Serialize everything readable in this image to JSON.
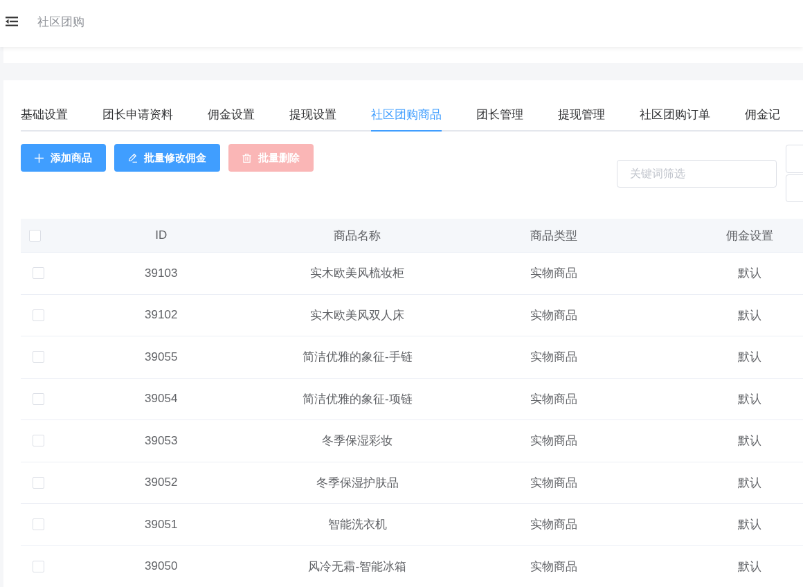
{
  "header": {
    "title": "社区团购"
  },
  "tabs": [
    {
      "label": "基础设置",
      "selected": false
    },
    {
      "label": "团长申请资料",
      "selected": false
    },
    {
      "label": "佣金设置",
      "selected": false
    },
    {
      "label": "提现设置",
      "selected": false
    },
    {
      "label": "社区团购商品",
      "selected": true
    },
    {
      "label": "团长管理",
      "selected": false
    },
    {
      "label": "提现管理",
      "selected": false
    },
    {
      "label": "社区团购订单",
      "selected": false
    },
    {
      "label": "佣金记",
      "selected": false
    }
  ],
  "toolbar": {
    "buttons": [
      {
        "kind": "add",
        "label": "添加商品",
        "disabled": false
      },
      {
        "kind": "edit",
        "label": "批量修改佣金",
        "disabled": false
      },
      {
        "kind": "delete",
        "label": "批量删除",
        "disabled": true
      }
    ],
    "search": {
      "placeholder": "关键词筛选"
    }
  },
  "table": {
    "columns": [
      "ID",
      "商品名称",
      "商品类型",
      "佣金设置"
    ],
    "select_all": {
      "checked": false
    },
    "rows": [
      {
        "checked": false,
        "id": "39103",
        "name": "实木欧美风梳妆柜",
        "type": "实物商品",
        "commission": "默认"
      },
      {
        "checked": false,
        "id": "39102",
        "name": "实木欧美风双人床",
        "type": "实物商品",
        "commission": "默认"
      },
      {
        "checked": false,
        "id": "39055",
        "name": "简洁优雅的象征-手链",
        "type": "实物商品",
        "commission": "默认"
      },
      {
        "checked": false,
        "id": "39054",
        "name": "简洁优雅的象征-项链",
        "type": "实物商品",
        "commission": "默认"
      },
      {
        "checked": false,
        "id": "39053",
        "name": "冬季保湿彩妆",
        "type": "实物商品",
        "commission": "默认"
      },
      {
        "checked": false,
        "id": "39052",
        "name": "冬季保湿护肤品",
        "type": "实物商品",
        "commission": "默认"
      },
      {
        "checked": false,
        "id": "39051",
        "name": "智能洗衣机",
        "type": "实物商品",
        "commission": "默认"
      },
      {
        "checked": false,
        "id": "39050",
        "name": "风冷无霜-智能冰箱",
        "type": "实物商品",
        "commission": "默认"
      }
    ]
  }
}
